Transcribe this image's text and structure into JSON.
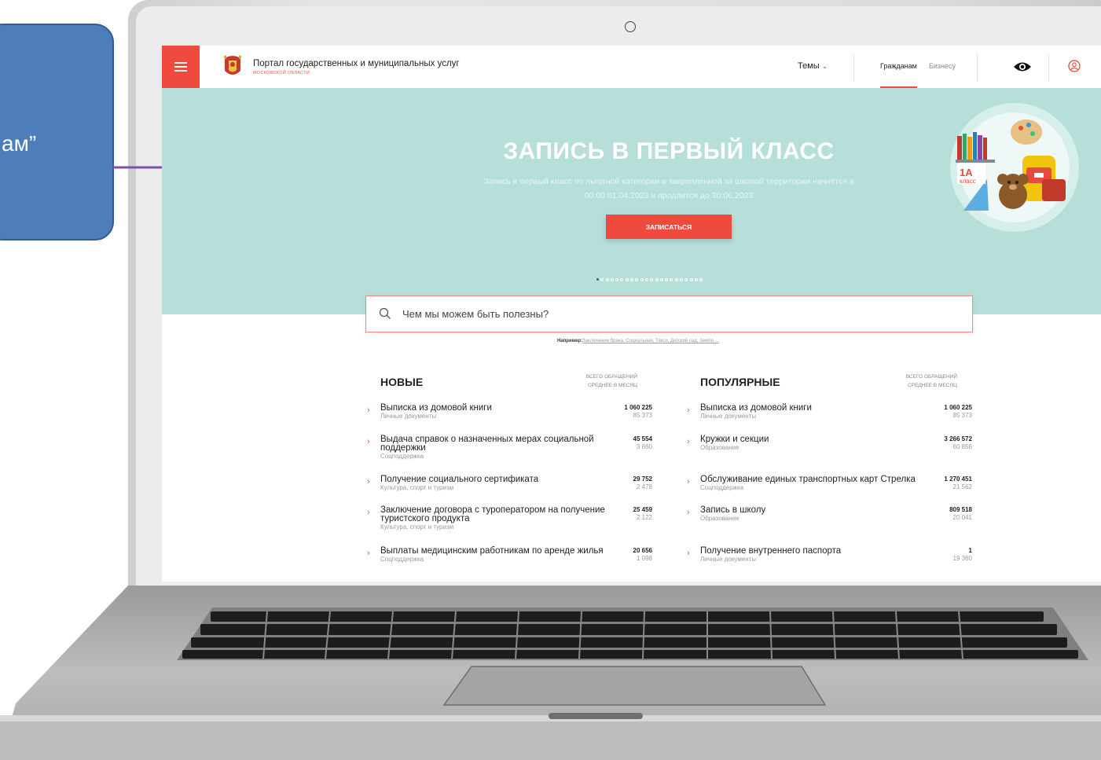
{
  "callout": {
    "line1": "”",
    "line2": "ам”"
  },
  "header": {
    "portal_title": "Портал государственных и муниципальных услуг",
    "portal_subtitle": "МОСКОВСКОЙ ОБЛАСТИ",
    "themes_label": "Темы",
    "nav_citizens": "Гражданам",
    "nav_business": "Бизнесу"
  },
  "hero": {
    "title": "ЗАПИСЬ В ПЕРВЫЙ КЛАСС",
    "text": "Запись в первый класс по льготной категории и закрепленной за школой территории начнётся в 00:00 01.04.2023 и продлится до 30.06.2023",
    "button_label": "ЗАПИСАТЬСЯ",
    "slides_total": 22,
    "slide_active": 1,
    "illustration_text": "1А класс"
  },
  "search": {
    "placeholder": "Чем мы можем быть полезны?",
    "examples_prefix": "Например:",
    "examples": "Заключение брака, Социальная, Такси, Детский сад, Земля ..."
  },
  "new_col": {
    "title": "НОВЫЕ",
    "meta1": "ВСЕГО ОБРАЩЕНИЙ",
    "meta2": "СРЕДНЕЕ В МЕСЯЦ",
    "items": [
      {
        "title": "Выписка из домовой книги",
        "cat": "Личные документы",
        "total": "1 060 225",
        "avg": "85 373"
      },
      {
        "title": "Выдача справок о назначенных мерах социальной поддержки",
        "cat": "Соцподдержка",
        "total": "45 554",
        "avg": "3 660"
      },
      {
        "title": "Получение социального сертификата",
        "cat": "Культура, спорт и туризм",
        "total": "29 752",
        "avg": "2 478"
      },
      {
        "title": "Заключение договора с туроператором на получение туристского продукта",
        "cat": "Культура, спорт и туризм",
        "total": "25 459",
        "avg": "2 122"
      },
      {
        "title": "Выплаты медицинским работникам по аренде жилья",
        "cat": "Соцподдержка",
        "total": "20 656",
        "avg": "1 098"
      }
    ]
  },
  "popular_col": {
    "title": "ПОПУЛЯРНЫЕ",
    "meta1": "ВСЕГО ОБРАЩЕНИЙ",
    "meta2": "СРЕДНЕЕ В МЕСЯЦ",
    "items": [
      {
        "title": "Выписка из домовой книги",
        "cat": "Личные документы",
        "total": "1 060 225",
        "avg": "85 373"
      },
      {
        "title": "Кружки и секции",
        "cat": "Образование",
        "total": "3 266 572",
        "avg": "60 856"
      },
      {
        "title": "Обслуживание единых транспортных карт Стрелка",
        "cat": "Соцподдержка",
        "total": "1 270 451",
        "avg": "21 562"
      },
      {
        "title": "Запись в школу",
        "cat": "Образование",
        "total": "809 518",
        "avg": "20 041"
      },
      {
        "title": "Получение внутреннего паспорта",
        "cat": "Личные документы",
        "total": "1",
        "avg": "19 360"
      }
    ]
  },
  "colors": {
    "accent": "#f04a3e",
    "hero_bg": "#b7dfd9",
    "callout": "#4d7ebb",
    "arrow": "#7b52a8"
  }
}
